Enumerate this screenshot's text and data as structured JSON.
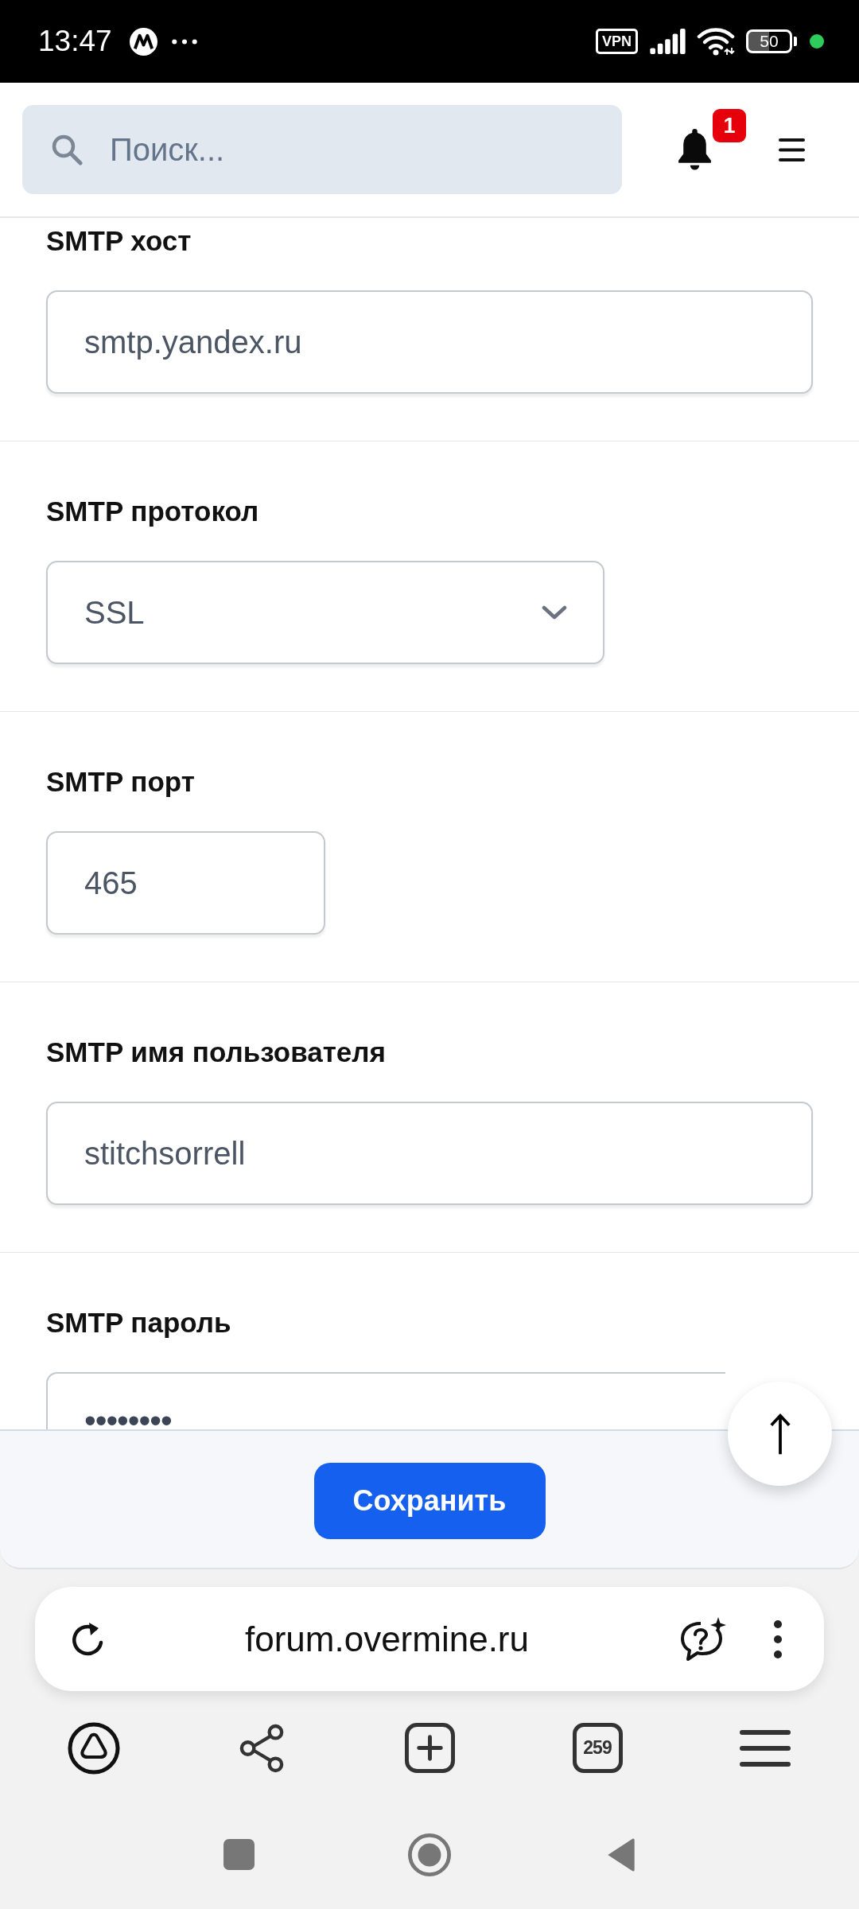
{
  "status_bar": {
    "time": "13:47",
    "vpn": "VPN",
    "battery": "50"
  },
  "header": {
    "search": {
      "placeholder": "Поиск..."
    },
    "notification_count": "1"
  },
  "settings": [
    {
      "label": "SMTP хост",
      "kind": "text",
      "value": "smtp.yandex.ru"
    },
    {
      "label": "SMTP протокол",
      "kind": "select",
      "value": "SSL"
    },
    {
      "label": "SMTP порт",
      "kind": "number",
      "value": "465"
    },
    {
      "label": "SMTP имя пользователя",
      "kind": "text",
      "value": "stitchsorrell"
    },
    {
      "label": "SMTP пароль",
      "kind": "password",
      "value": "••••••••"
    }
  ],
  "save_button": "Сохранить",
  "browser": {
    "url": "forum.overmine.ru",
    "tab_count": "259"
  }
}
